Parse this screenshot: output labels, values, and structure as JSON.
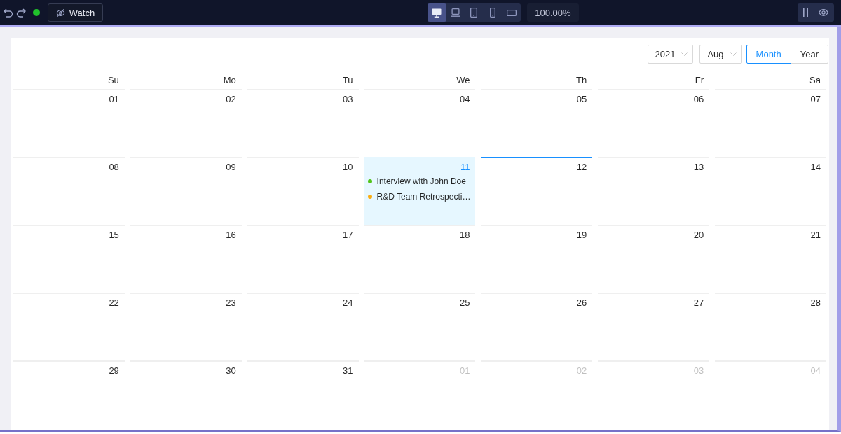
{
  "toolbar": {
    "watch_button": {
      "label": "Watch"
    },
    "devices": [
      {
        "kind": "desktop",
        "selected": true
      },
      {
        "kind": "laptop",
        "selected": false
      },
      {
        "kind": "tablet",
        "selected": false
      },
      {
        "kind": "phone",
        "selected": false
      },
      {
        "kind": "tablet_landscape",
        "selected": false
      }
    ],
    "zoom": "100.00%"
  },
  "calendar": {
    "year_select": {
      "value": "2021"
    },
    "month_select": {
      "value": "Aug"
    },
    "modes": [
      {
        "label": "Month",
        "selected": true
      },
      {
        "label": "Year",
        "selected": false
      }
    ],
    "weekdays": [
      "Su",
      "Mo",
      "Tu",
      "We",
      "Th",
      "Fr",
      "Sa"
    ],
    "weeks": [
      [
        {
          "date": "01",
          "in_month": true,
          "selected": false,
          "today": false
        },
        {
          "date": "02",
          "in_month": true,
          "selected": false,
          "today": false
        },
        {
          "date": "03",
          "in_month": true,
          "selected": false,
          "today": false
        },
        {
          "date": "04",
          "in_month": true,
          "selected": false,
          "today": false
        },
        {
          "date": "05",
          "in_month": true,
          "selected": false,
          "today": false
        },
        {
          "date": "06",
          "in_month": true,
          "selected": false,
          "today": false
        },
        {
          "date": "07",
          "in_month": true,
          "selected": false,
          "today": false
        }
      ],
      [
        {
          "date": "08",
          "in_month": true,
          "selected": false,
          "today": false
        },
        {
          "date": "09",
          "in_month": true,
          "selected": false,
          "today": false
        },
        {
          "date": "10",
          "in_month": true,
          "selected": false,
          "today": false
        },
        {
          "date": "11",
          "in_month": true,
          "selected": true,
          "today": false,
          "events": [
            {
              "text": "Interview with John Doe",
              "color": "#52c41a"
            },
            {
              "text": "R&D Team Retrospecti…",
              "color": "#faad14"
            }
          ]
        },
        {
          "date": "12",
          "in_month": true,
          "selected": false,
          "today": true
        },
        {
          "date": "13",
          "in_month": true,
          "selected": false,
          "today": false
        },
        {
          "date": "14",
          "in_month": true,
          "selected": false,
          "today": false
        }
      ],
      [
        {
          "date": "15",
          "in_month": true,
          "selected": false,
          "today": false
        },
        {
          "date": "16",
          "in_month": true,
          "selected": false,
          "today": false
        },
        {
          "date": "17",
          "in_month": true,
          "selected": false,
          "today": false
        },
        {
          "date": "18",
          "in_month": true,
          "selected": false,
          "today": false
        },
        {
          "date": "19",
          "in_month": true,
          "selected": false,
          "today": false
        },
        {
          "date": "20",
          "in_month": true,
          "selected": false,
          "today": false
        },
        {
          "date": "21",
          "in_month": true,
          "selected": false,
          "today": false
        }
      ],
      [
        {
          "date": "22",
          "in_month": true,
          "selected": false,
          "today": false
        },
        {
          "date": "23",
          "in_month": true,
          "selected": false,
          "today": false
        },
        {
          "date": "24",
          "in_month": true,
          "selected": false,
          "today": false
        },
        {
          "date": "25",
          "in_month": true,
          "selected": false,
          "today": false
        },
        {
          "date": "26",
          "in_month": true,
          "selected": false,
          "today": false
        },
        {
          "date": "27",
          "in_month": true,
          "selected": false,
          "today": false
        },
        {
          "date": "28",
          "in_month": true,
          "selected": false,
          "today": false
        }
      ],
      [
        {
          "date": "29",
          "in_month": true,
          "selected": false,
          "today": false
        },
        {
          "date": "30",
          "in_month": true,
          "selected": false,
          "today": false
        },
        {
          "date": "31",
          "in_month": true,
          "selected": false,
          "today": false
        },
        {
          "date": "01",
          "in_month": false,
          "selected": false,
          "today": false
        },
        {
          "date": "02",
          "in_month": false,
          "selected": false,
          "today": false
        },
        {
          "date": "03",
          "in_month": false,
          "selected": false,
          "today": false
        },
        {
          "date": "04",
          "in_month": false,
          "selected": false,
          "today": false
        }
      ]
    ]
  }
}
